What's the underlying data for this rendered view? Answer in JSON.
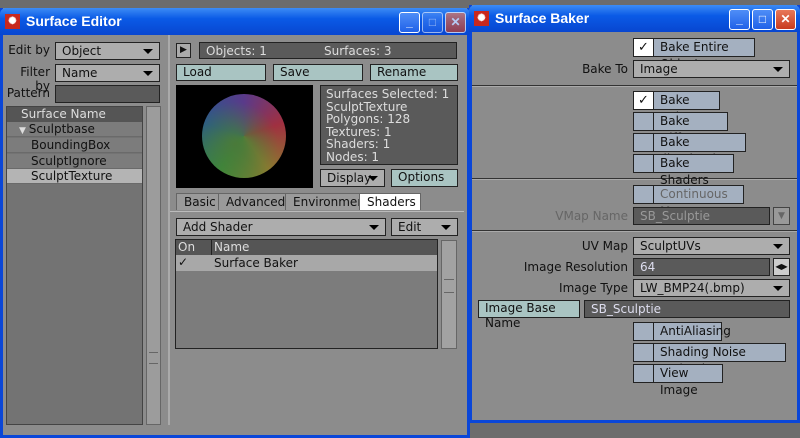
{
  "surface_editor": {
    "title": "Surface Editor",
    "edit_by_label": "Edit by",
    "edit_by_value": "Object",
    "filter_by_label": "Filter by",
    "filter_by_value": "Name",
    "pattern_label": "Pattern",
    "pattern_value": "",
    "list_header": "Surface Name",
    "surfaces": [
      "Sculptbase",
      "BoundingBox",
      "SculptIgnore",
      "SculptTexture"
    ],
    "objects": "Objects: 1",
    "surfaces_count": "Surfaces: 3",
    "load": "Load",
    "save": "Save",
    "rename": "Rename",
    "info": [
      "Surfaces Selected: 1",
      "SculptTexture",
      "Polygons: 128",
      "Textures: 1",
      "Shaders: 1",
      "Nodes: 1"
    ],
    "display": "Display",
    "options": "Options",
    "tabs": [
      "Basic",
      "Advanced",
      "Environment",
      "Shaders"
    ],
    "add_shader": "Add Shader",
    "edit": "Edit",
    "table_headers": [
      "On",
      "Name"
    ],
    "shaders": [
      {
        "on": "✓",
        "name": "Surface Baker"
      }
    ]
  },
  "surface_baker": {
    "title": "Surface Baker",
    "bake_entire_object": "Bake Entire Object",
    "bake_to_label": "Bake To",
    "bake_to_value": "Image",
    "bake_color": "Bake Color",
    "bake_diffuse": "Bake Diffuse",
    "bake_illumination": "Bake Illumination",
    "bake_shaders": "Bake Shaders",
    "continuous_map": "Continuous Map",
    "vmap_name_label": "VMap Name",
    "vmap_name_value": "SB_Sculptie",
    "uv_map_label": "UV Map",
    "uv_map_value": "SculptUVs",
    "image_resolution_label": "Image Resolution",
    "image_resolution_value": "64",
    "image_type_label": "Image Type",
    "image_type_value": "LW_BMP24(.bmp)",
    "image_base_name_button": "Image Base Name",
    "image_base_name_value": "SB_Sculptie",
    "antialiasing": "AntiAliasing",
    "shading_noise_reduction": "Shading Noise Reduction",
    "view_image": "View Image",
    "check": "✓"
  }
}
